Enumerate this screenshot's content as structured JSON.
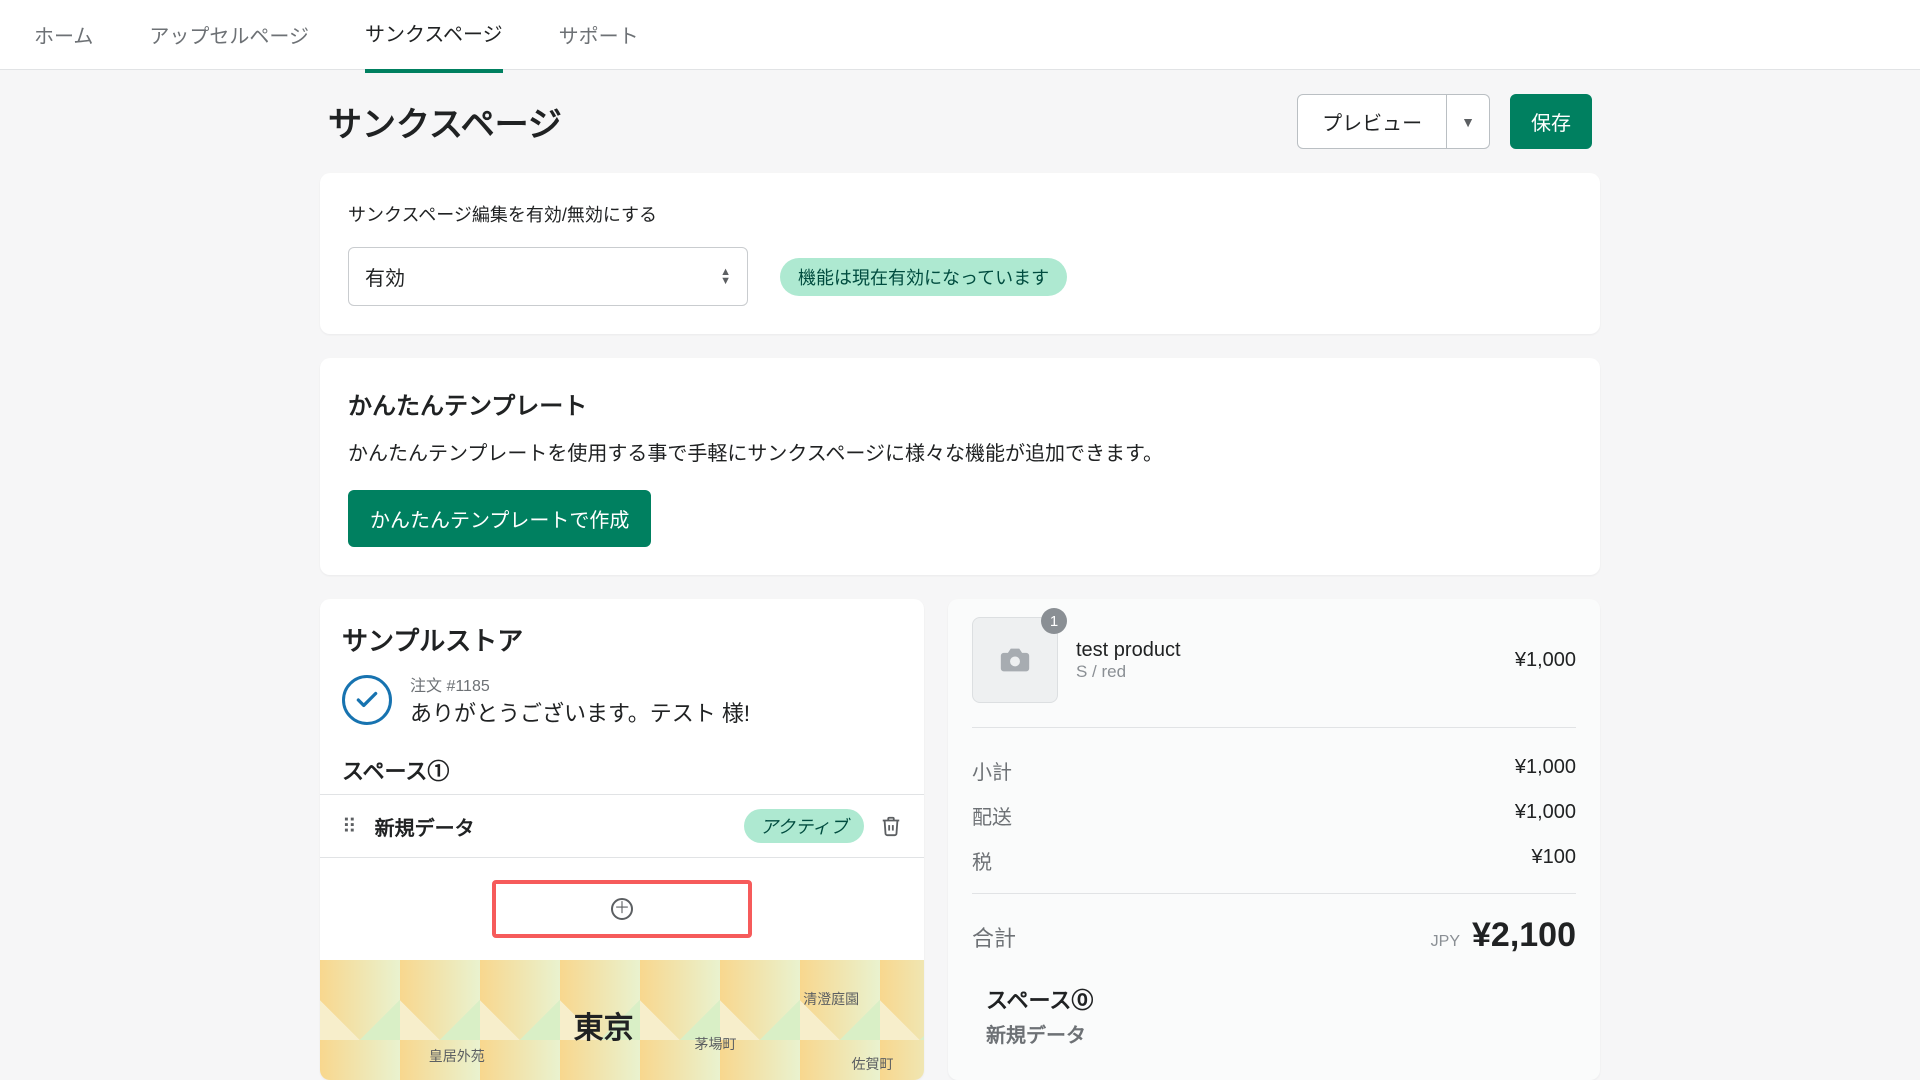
{
  "tabs": [
    "ホーム",
    "アップセルページ",
    "サンクスページ",
    "サポート"
  ],
  "activeTab": 2,
  "page": {
    "title": "サンクスページ"
  },
  "header": {
    "preview": "プレビュー",
    "save": "保存"
  },
  "enableCard": {
    "label": "サンクスページ編集を有効/無効にする",
    "selectValue": "有効",
    "statusBadge": "機能は現在有効になっています"
  },
  "templateCard": {
    "title": "かんたんテンプレート",
    "desc": "かんたんテンプレートを使用する事で手軽にサンクスページに様々な機能が追加できます。",
    "button": "かんたんテンプレートで作成"
  },
  "sample": {
    "storeName": "サンプルストア",
    "orderNo": "注文 #1185",
    "thanks": "ありがとうございます。テスト 様!",
    "spaceLabel": "スペース①",
    "dataRow": {
      "label": "新規データ",
      "status": "アクティブ"
    },
    "mapLabel": "東京",
    "mapSubs": [
      "皇居外苑",
      "清澄庭園",
      "茅場町",
      "佐賀町"
    ]
  },
  "order": {
    "item": {
      "name": "test product",
      "variant": "S / red",
      "qty": "1",
      "price": "¥1,000"
    },
    "lines": [
      {
        "label": "小計",
        "value": "¥1,000"
      },
      {
        "label": "配送",
        "value": "¥1,000"
      },
      {
        "label": "税",
        "value": "¥100"
      }
    ],
    "totalLabel": "合計",
    "currency": "JPY",
    "totalAmount": "¥2,100",
    "spaceLabel": "スペース⓪",
    "peek": "新規データ"
  }
}
